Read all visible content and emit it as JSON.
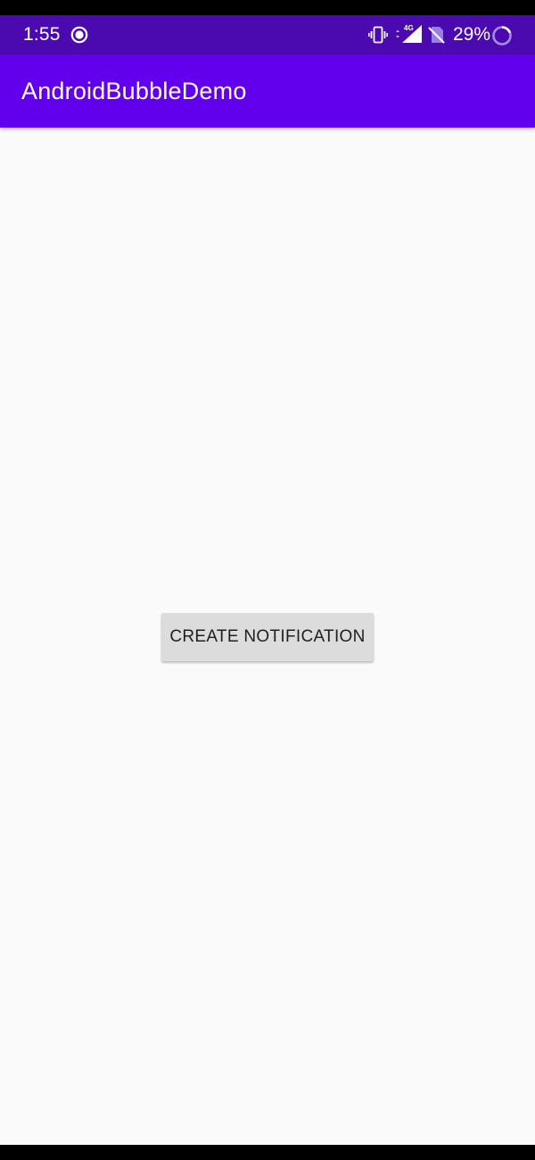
{
  "status_bar": {
    "time": "1:55",
    "recording_icon": "record-icon",
    "vibrate_icon": "vibrate-icon",
    "network_label": "4G",
    "signal_icon": "cell-signal-icon",
    "sim_icon": "no-sim-icon",
    "battery_percent": "29%",
    "battery_icon": "battery-ring-icon",
    "background_color": "#4a0ab0"
  },
  "app_bar": {
    "title": "AndroidBubbleDemo",
    "background_color": "#6200ee"
  },
  "main": {
    "create_notification_label": "CREATE NOTIFICATION",
    "background_color": "#fafafa",
    "button_color": "#dcdcdc"
  }
}
